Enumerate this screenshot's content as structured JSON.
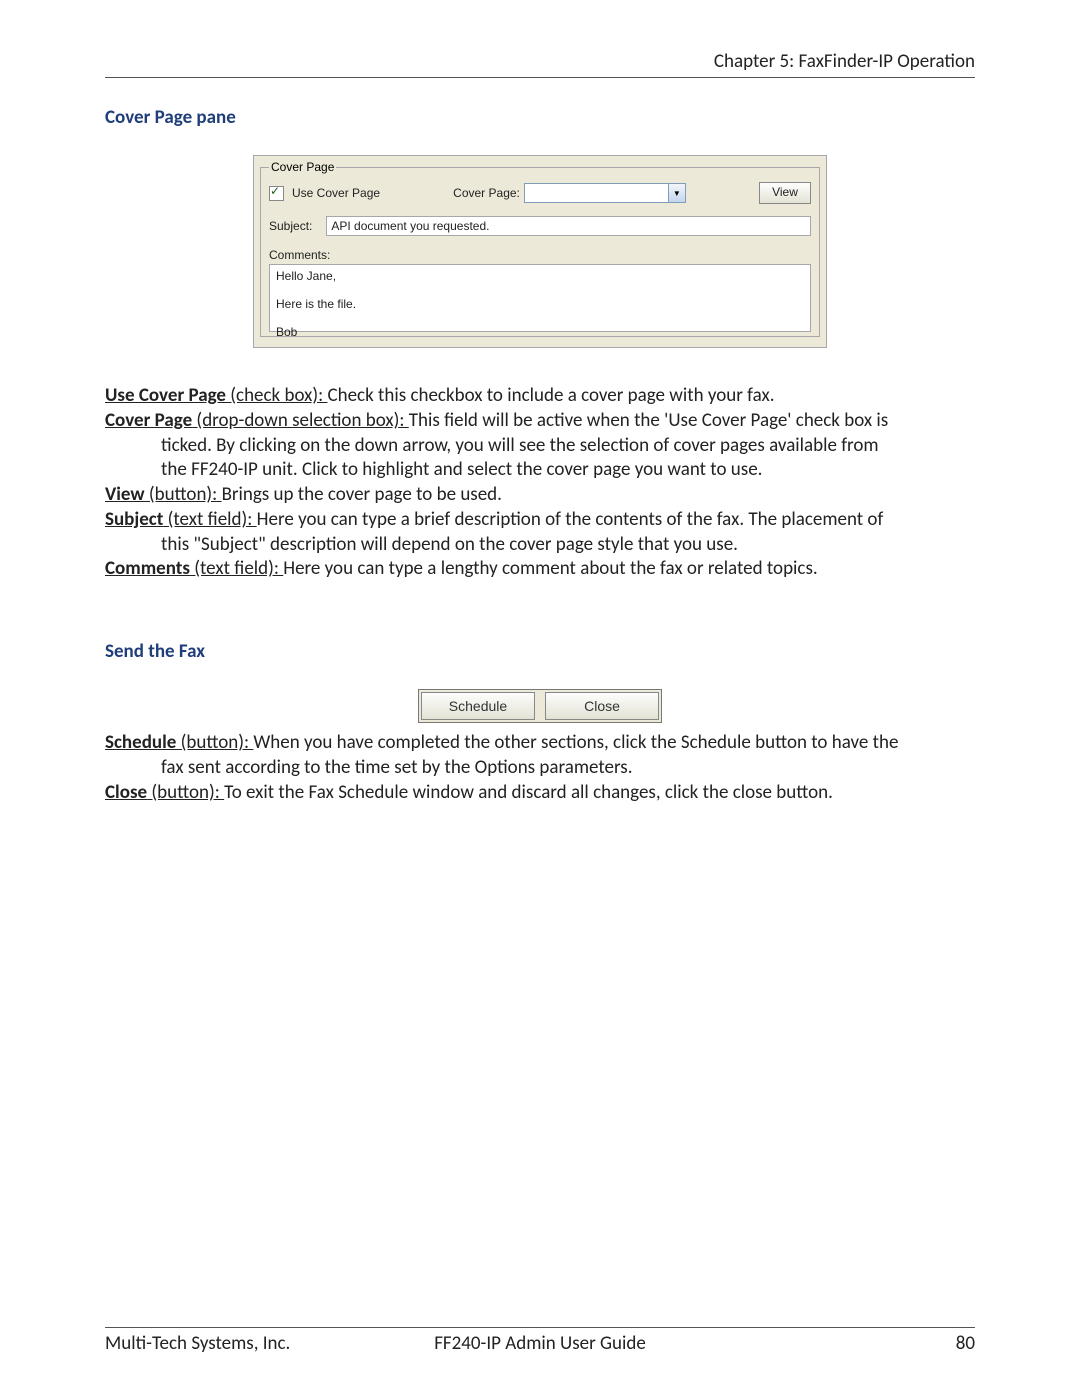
{
  "header": {
    "chapter": "Chapter 5: FaxFinder-IP Operation"
  },
  "sections": {
    "coverPaneTitle": "Cover Page pane",
    "sendFaxTitle": "Send the Fax"
  },
  "coverPagePane": {
    "legend": "Cover Page",
    "useCoverCheckboxLabel": "Use Cover Page",
    "coverPageDropdownLabel": "Cover Page:",
    "viewButton": "View",
    "subjectLabel": "Subject:",
    "subjectValue": "API document you requested.",
    "commentsLabel": "Comments:",
    "commentsValue": "Hello Jane,\n\nHere is the file.\n\nBob"
  },
  "defs": {
    "useCoverPage": {
      "term": "Use Cover Page",
      "paren": " (check box): ",
      "text": "Check this checkbox to include a cover page with your fax."
    },
    "coverPage": {
      "term": "Cover Page",
      "paren": " (drop-down selection box): ",
      "line1": "This field will be active when the 'Use Cover Page' check box is",
      "line2": "ticked. By clicking on the down arrow, you will see the selection of cover pages available from",
      "line3": "the FF240-IP unit. Click to highlight and select the cover page you want to use."
    },
    "view": {
      "term": "View",
      "paren": " (button): ",
      "text": "Brings up the cover page to be used."
    },
    "subject": {
      "term": "Subject",
      "paren": " (text field): ",
      "line1": "Here you can type a brief description of the contents of the fax. The placement of",
      "line2": "this \"Subject\" description will depend on the cover page style that you use."
    },
    "comments": {
      "term": "Comments",
      "paren": " (text field): ",
      "text": "Here you can type a lengthy comment about the fax or related topics."
    },
    "schedule": {
      "term": "Schedule",
      "paren": " (button): ",
      "line1": "When you have completed the other sections, click the Schedule button to have the",
      "line2": "fax sent according to the time set by the Options parameters."
    },
    "close": {
      "term": "Close",
      "paren": " (button): ",
      "text": "To exit the Fax Schedule window and discard all changes, click the close button."
    }
  },
  "sendFaxButtons": {
    "schedule": "Schedule",
    "close": "Close"
  },
  "footer": {
    "left": "Multi-Tech Systems, Inc.",
    "center": "FF240-IP Admin User Guide",
    "right": "80"
  }
}
